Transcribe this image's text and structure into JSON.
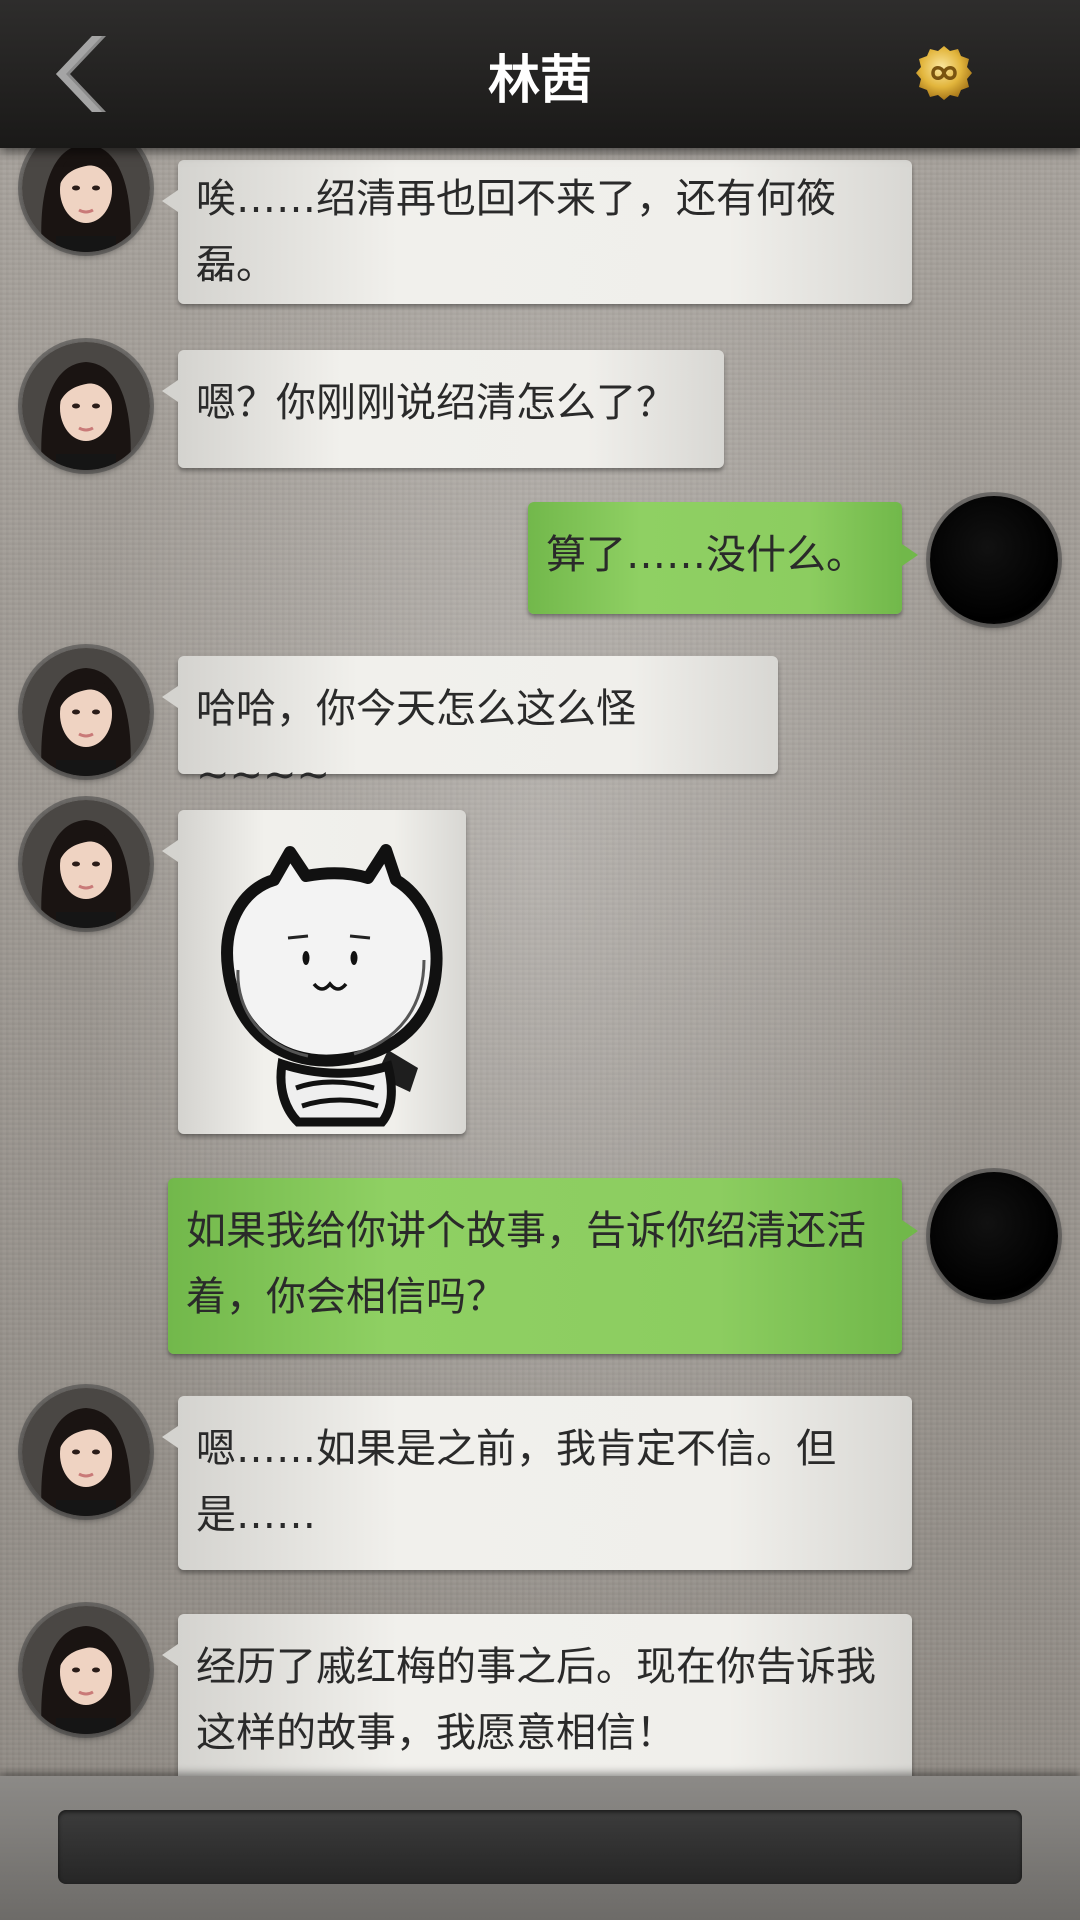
{
  "header": {
    "title": "林茜",
    "back_icon": "chevron-left-icon",
    "coin_icon": "infinity-coin-icon",
    "coin_color": "#e2b53c"
  },
  "messages": [
    {
      "sender": "other",
      "text": "唉……绍清再也回不来了，还有何筱磊。"
    },
    {
      "sender": "other",
      "text": "嗯？你刚刚说绍清怎么了？"
    },
    {
      "sender": "me",
      "text": "算了……没什么。"
    },
    {
      "sender": "other",
      "text": "哈哈，你今天怎么这么怪~~~~"
    },
    {
      "sender": "other",
      "type": "sticker",
      "sticker": "cat-sticker"
    },
    {
      "sender": "me",
      "text": "如果我给你讲个故事，告诉你绍清还活着，你会相信吗？"
    },
    {
      "sender": "other",
      "text": "嗯……如果是之前，我肯定不信。但是……"
    },
    {
      "sender": "other",
      "text": "经历了戚红梅的事之后。现在你告诉我这样的故事，我愿意相信！"
    }
  ],
  "input": {
    "placeholder": ""
  },
  "colors": {
    "header_bg": "#1f1e1d",
    "bubble_other": "#efeeea",
    "bubble_me": "#8ccd60",
    "background": "#a09b95"
  }
}
